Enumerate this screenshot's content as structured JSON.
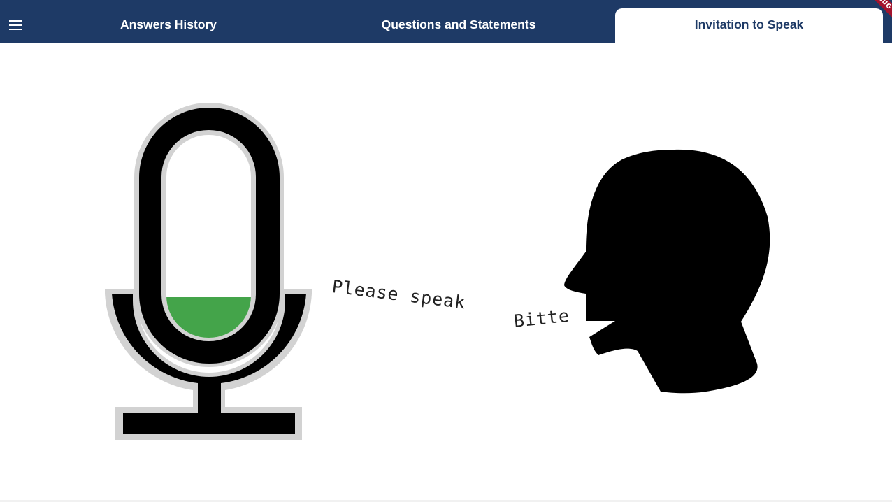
{
  "app_bar": {
    "menu_icon": "hamburger-menu-icon",
    "tabs": [
      {
        "label": "Answers History",
        "selected": false
      },
      {
        "label": "Questions and Statements",
        "selected": false
      },
      {
        "label": "Invitation to Speak",
        "selected": true
      }
    ],
    "debug_banner": "DEBUG",
    "background_color": "#1e3a66"
  },
  "speak_screen": {
    "prompt_english": "Please speak",
    "prompt_german": "Bitte",
    "microphone_icon": "microphone-icon",
    "speaker_icon": "speaking-head-icon",
    "input_level": 0.2,
    "level_color": "#44a44a"
  }
}
